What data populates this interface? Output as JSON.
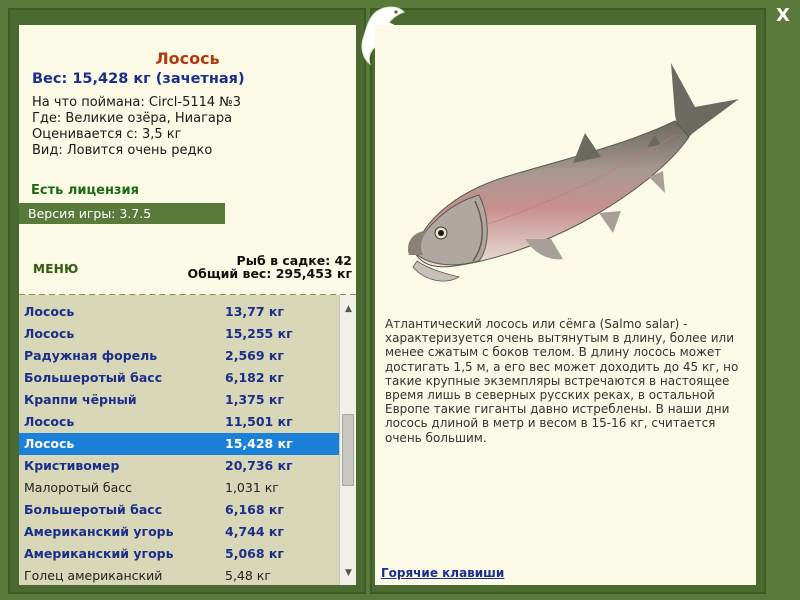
{
  "fish": {
    "title": "Лосось",
    "weight_line": "Вес: 15,428 кг (зачетная)",
    "caught_with": "На что поймана: Circl-5114 №3",
    "location": "Где: Великие озёра, Ниагара",
    "rated_from": "Оценивается с: 3,5 кг",
    "rarity": "Вид: Ловится очень редко"
  },
  "license": "Есть лицензия",
  "version": "Версия игры: 3.7.5",
  "menu_label": "МЕНЮ",
  "stats": {
    "count": "Рыб в садке: 42",
    "total_weight": "Общий вес: 295,453 кг"
  },
  "fish_list": [
    {
      "name": "Лосось",
      "weight": "13,77 кг",
      "style": "bold"
    },
    {
      "name": "Лосось",
      "weight": "15,255 кг",
      "style": "bold"
    },
    {
      "name": "Радужная форель",
      "weight": "2,569 кг",
      "style": "bold"
    },
    {
      "name": "Большеротый басс",
      "weight": "6,182 кг",
      "style": "bold"
    },
    {
      "name": "Краппи чёрный",
      "weight": "1,375 кг",
      "style": "bold"
    },
    {
      "name": "Лосось",
      "weight": "11,501 кг",
      "style": "bold"
    },
    {
      "name": "Лосось",
      "weight": "15,428 кг",
      "style": "selected"
    },
    {
      "name": "Кристивомер",
      "weight": "20,736 кг",
      "style": "bold"
    },
    {
      "name": "Малоротый басс",
      "weight": "1,031 кг",
      "style": "normal"
    },
    {
      "name": "Большеротый басс",
      "weight": "6,168 кг",
      "style": "bold"
    },
    {
      "name": "Американский угорь",
      "weight": "4,744 кг",
      "style": "bold"
    },
    {
      "name": "Американский угорь",
      "weight": "5,068 кг",
      "style": "bold"
    },
    {
      "name": "Голец американский",
      "weight": "5,48 кг",
      "style": "normal"
    }
  ],
  "scrollbar": {
    "position": 0.55
  },
  "description": "Атлантический лосось или сёмга (Salmo salar) - характеризуется очень вытянутым в длину, более или менее сжатым с боков телом. В длину лосось может достигать 1,5 м, а его вес может доходить до 45 кг, но такие крупные экземпляры встречаются в настоящее время лишь в северных русских реках, в остальной Европе такие гиганты давно истреблены. В наши дни лосось длиной в метр и весом в 15-16 кг, считается очень большим.",
  "hotkeys_label": "Горячие клавиши",
  "close_label": "X",
  "colors": {
    "frame_green": "#5a7a3c",
    "panel_cream": "#fafae6",
    "list_bg": "#d8d8b8",
    "title_red": "#b03a10",
    "text_blue": "#1c2e8a",
    "license_green": "#1f6a12",
    "selection_blue": "#1a80d8"
  }
}
